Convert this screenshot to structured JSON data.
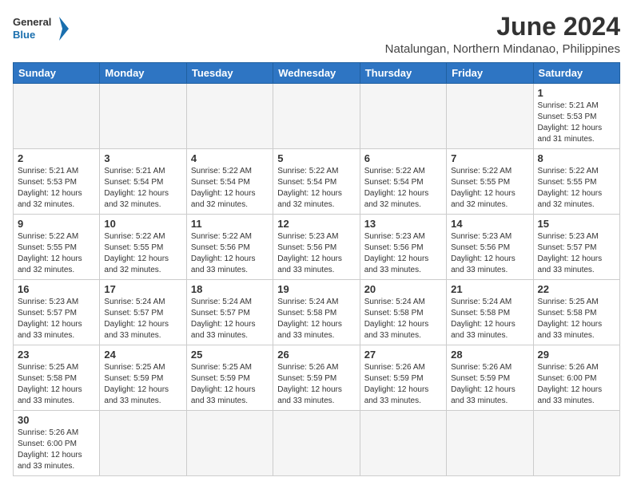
{
  "logo": {
    "text_general": "General",
    "text_blue": "Blue"
  },
  "title": "June 2024",
  "subtitle": "Natalungan, Northern Mindanao, Philippines",
  "weekdays": [
    "Sunday",
    "Monday",
    "Tuesday",
    "Wednesday",
    "Thursday",
    "Friday",
    "Saturday"
  ],
  "weeks": [
    [
      {
        "day": "",
        "info": ""
      },
      {
        "day": "",
        "info": ""
      },
      {
        "day": "",
        "info": ""
      },
      {
        "day": "",
        "info": ""
      },
      {
        "day": "",
        "info": ""
      },
      {
        "day": "",
        "info": ""
      },
      {
        "day": "1",
        "info": "Sunrise: 5:21 AM\nSunset: 5:53 PM\nDaylight: 12 hours\nand 31 minutes."
      }
    ],
    [
      {
        "day": "2",
        "info": "Sunrise: 5:21 AM\nSunset: 5:53 PM\nDaylight: 12 hours\nand 32 minutes."
      },
      {
        "day": "3",
        "info": "Sunrise: 5:21 AM\nSunset: 5:54 PM\nDaylight: 12 hours\nand 32 minutes."
      },
      {
        "day": "4",
        "info": "Sunrise: 5:22 AM\nSunset: 5:54 PM\nDaylight: 12 hours\nand 32 minutes."
      },
      {
        "day": "5",
        "info": "Sunrise: 5:22 AM\nSunset: 5:54 PM\nDaylight: 12 hours\nand 32 minutes."
      },
      {
        "day": "6",
        "info": "Sunrise: 5:22 AM\nSunset: 5:54 PM\nDaylight: 12 hours\nand 32 minutes."
      },
      {
        "day": "7",
        "info": "Sunrise: 5:22 AM\nSunset: 5:55 PM\nDaylight: 12 hours\nand 32 minutes."
      },
      {
        "day": "8",
        "info": "Sunrise: 5:22 AM\nSunset: 5:55 PM\nDaylight: 12 hours\nand 32 minutes."
      }
    ],
    [
      {
        "day": "9",
        "info": "Sunrise: 5:22 AM\nSunset: 5:55 PM\nDaylight: 12 hours\nand 32 minutes."
      },
      {
        "day": "10",
        "info": "Sunrise: 5:22 AM\nSunset: 5:55 PM\nDaylight: 12 hours\nand 32 minutes."
      },
      {
        "day": "11",
        "info": "Sunrise: 5:22 AM\nSunset: 5:56 PM\nDaylight: 12 hours\nand 33 minutes."
      },
      {
        "day": "12",
        "info": "Sunrise: 5:23 AM\nSunset: 5:56 PM\nDaylight: 12 hours\nand 33 minutes."
      },
      {
        "day": "13",
        "info": "Sunrise: 5:23 AM\nSunset: 5:56 PM\nDaylight: 12 hours\nand 33 minutes."
      },
      {
        "day": "14",
        "info": "Sunrise: 5:23 AM\nSunset: 5:56 PM\nDaylight: 12 hours\nand 33 minutes."
      },
      {
        "day": "15",
        "info": "Sunrise: 5:23 AM\nSunset: 5:57 PM\nDaylight: 12 hours\nand 33 minutes."
      }
    ],
    [
      {
        "day": "16",
        "info": "Sunrise: 5:23 AM\nSunset: 5:57 PM\nDaylight: 12 hours\nand 33 minutes."
      },
      {
        "day": "17",
        "info": "Sunrise: 5:24 AM\nSunset: 5:57 PM\nDaylight: 12 hours\nand 33 minutes."
      },
      {
        "day": "18",
        "info": "Sunrise: 5:24 AM\nSunset: 5:57 PM\nDaylight: 12 hours\nand 33 minutes."
      },
      {
        "day": "19",
        "info": "Sunrise: 5:24 AM\nSunset: 5:58 PM\nDaylight: 12 hours\nand 33 minutes."
      },
      {
        "day": "20",
        "info": "Sunrise: 5:24 AM\nSunset: 5:58 PM\nDaylight: 12 hours\nand 33 minutes."
      },
      {
        "day": "21",
        "info": "Sunrise: 5:24 AM\nSunset: 5:58 PM\nDaylight: 12 hours\nand 33 minutes."
      },
      {
        "day": "22",
        "info": "Sunrise: 5:25 AM\nSunset: 5:58 PM\nDaylight: 12 hours\nand 33 minutes."
      }
    ],
    [
      {
        "day": "23",
        "info": "Sunrise: 5:25 AM\nSunset: 5:58 PM\nDaylight: 12 hours\nand 33 minutes."
      },
      {
        "day": "24",
        "info": "Sunrise: 5:25 AM\nSunset: 5:59 PM\nDaylight: 12 hours\nand 33 minutes."
      },
      {
        "day": "25",
        "info": "Sunrise: 5:25 AM\nSunset: 5:59 PM\nDaylight: 12 hours\nand 33 minutes."
      },
      {
        "day": "26",
        "info": "Sunrise: 5:26 AM\nSunset: 5:59 PM\nDaylight: 12 hours\nand 33 minutes."
      },
      {
        "day": "27",
        "info": "Sunrise: 5:26 AM\nSunset: 5:59 PM\nDaylight: 12 hours\nand 33 minutes."
      },
      {
        "day": "28",
        "info": "Sunrise: 5:26 AM\nSunset: 5:59 PM\nDaylight: 12 hours\nand 33 minutes."
      },
      {
        "day": "29",
        "info": "Sunrise: 5:26 AM\nSunset: 6:00 PM\nDaylight: 12 hours\nand 33 minutes."
      }
    ],
    [
      {
        "day": "30",
        "info": "Sunrise: 5:26 AM\nSunset: 6:00 PM\nDaylight: 12 hours\nand 33 minutes."
      },
      {
        "day": "",
        "info": ""
      },
      {
        "day": "",
        "info": ""
      },
      {
        "day": "",
        "info": ""
      },
      {
        "day": "",
        "info": ""
      },
      {
        "day": "",
        "info": ""
      },
      {
        "day": "",
        "info": ""
      }
    ]
  ]
}
